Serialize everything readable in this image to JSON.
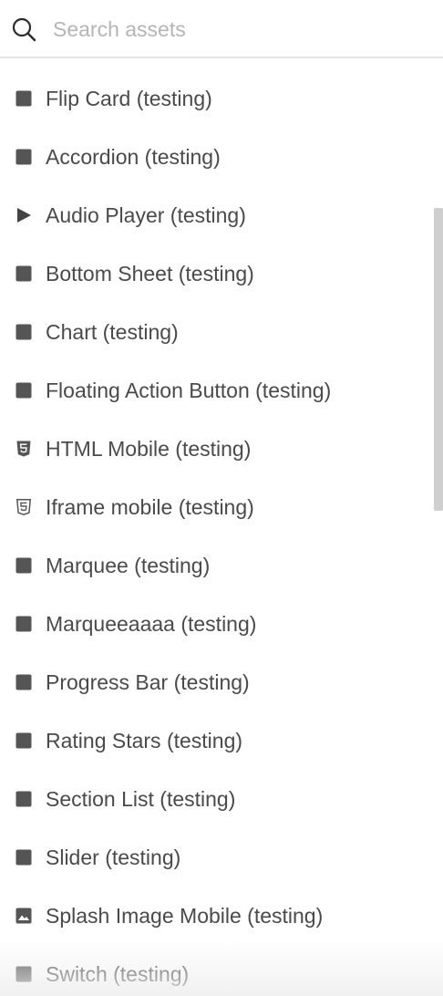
{
  "search": {
    "placeholder": "Search assets",
    "value": ""
  },
  "assets": [
    {
      "label": "Flip Card (testing)",
      "icon": "square-icon"
    },
    {
      "label": "Accordion (testing)",
      "icon": "square-icon"
    },
    {
      "label": "Audio Player (testing)",
      "icon": "play-icon"
    },
    {
      "label": "Bottom Sheet (testing)",
      "icon": "square-icon"
    },
    {
      "label": "Chart (testing)",
      "icon": "square-icon"
    },
    {
      "label": "Floating Action Button (testing)",
      "icon": "square-icon"
    },
    {
      "label": "HTML Mobile (testing)",
      "icon": "html5-icon"
    },
    {
      "label": "Iframe mobile (testing)",
      "icon": "html5-outline-icon"
    },
    {
      "label": "Marquee (testing)",
      "icon": "square-icon"
    },
    {
      "label": "Marqueeaaaa (testing)",
      "icon": "square-icon"
    },
    {
      "label": "Progress Bar (testing)",
      "icon": "square-icon"
    },
    {
      "label": "Rating Stars (testing)",
      "icon": "square-icon"
    },
    {
      "label": "Section List (testing)",
      "icon": "square-icon"
    },
    {
      "label": "Slider (testing)",
      "icon": "square-icon"
    },
    {
      "label": "Splash Image Mobile (testing)",
      "icon": "image-icon"
    },
    {
      "label": "Switch (testing)",
      "icon": "square-icon"
    }
  ],
  "colors": {
    "text": "#4a4a4a",
    "icon": "#555555",
    "placeholder": "#b5b5b5",
    "divider": "#e4e4e4",
    "scrollbar": "#cfcfcf"
  }
}
